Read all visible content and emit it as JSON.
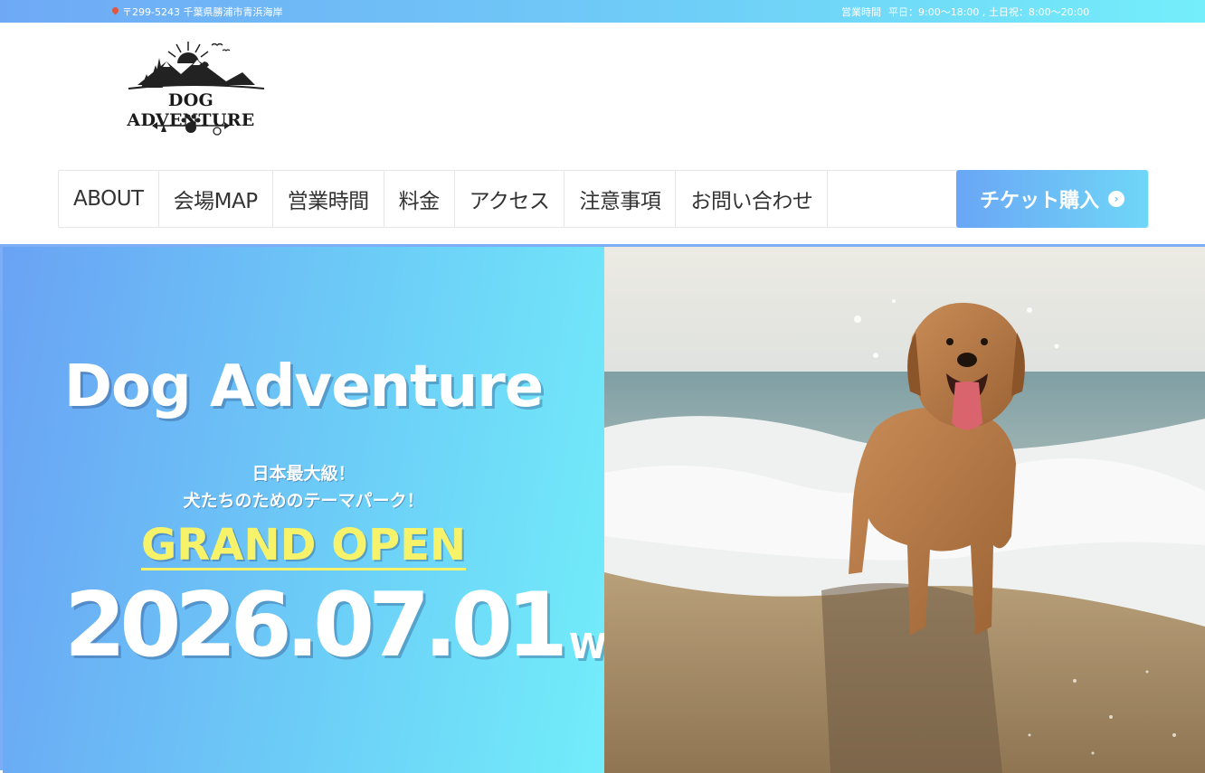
{
  "topbar": {
    "address": "〒299-5243 千葉県勝浦市青浜海岸",
    "hours_label": "営業時間",
    "hours_value": "平日：9:00〜18:00 , 土日祝：8:00〜20:00"
  },
  "logo": {
    "brand": "DOG ADVENTURE"
  },
  "nav": {
    "items": [
      "ABOUT",
      "会場MAP",
      "営業時間",
      "料金",
      "アクセス",
      "注意事項",
      "お問い合わせ"
    ],
    "cta_label": "チケット購入"
  },
  "hero": {
    "title": "Dog Adventure",
    "sub1": "日本最大級！",
    "sub2": "犬たちのためのテーマパーク！",
    "grand": "GRAND OPEN",
    "date": "2026.07.01",
    "dow": "WED"
  },
  "colors": {
    "accent_blue": "#6aa2f4",
    "accent_cyan": "#72edfa",
    "grand_yellow": "#f6f36a"
  }
}
